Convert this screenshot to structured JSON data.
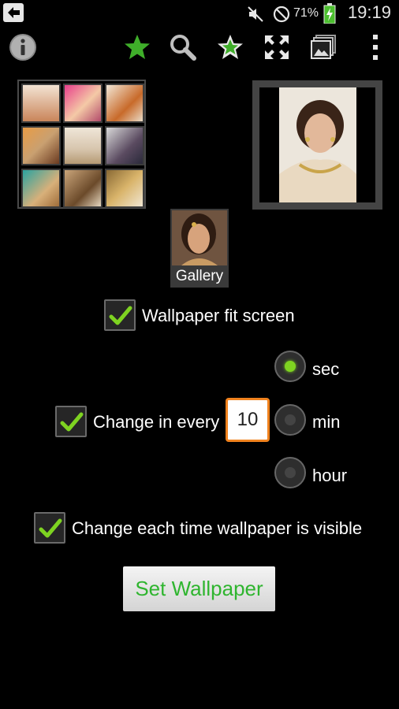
{
  "status_bar": {
    "time": "19:19",
    "battery_percent": "71%",
    "icons": [
      "back-icon",
      "mute-icon",
      "do-not-disturb-icon",
      "battery-charging-icon"
    ]
  },
  "toolbar": {
    "icons": [
      "info-icon",
      "favorite-star-icon",
      "search-icon",
      "star-add-icon",
      "fullscreen-icon",
      "gallery-stack-icon",
      "overflow-menu-icon"
    ],
    "accent": "#4cbf2f"
  },
  "gallery": {
    "label": "Gallery"
  },
  "options": {
    "fit_screen": {
      "label": "Wallpaper fit screen",
      "checked": true
    },
    "change_every": {
      "label": "Change in every",
      "checked": true,
      "value": "10"
    },
    "units": [
      {
        "label": "sec",
        "selected": true
      },
      {
        "label": "min",
        "selected": false
      },
      {
        "label": "hour",
        "selected": false
      }
    ],
    "change_visible": {
      "label": "Change each time wallpaper is visible",
      "checked": true
    }
  },
  "actions": {
    "set_wallpaper": "Set Wallpaper"
  },
  "colors": {
    "check": "#7ed321",
    "input_border": "#f0821e",
    "button_text": "#2fb52f"
  }
}
